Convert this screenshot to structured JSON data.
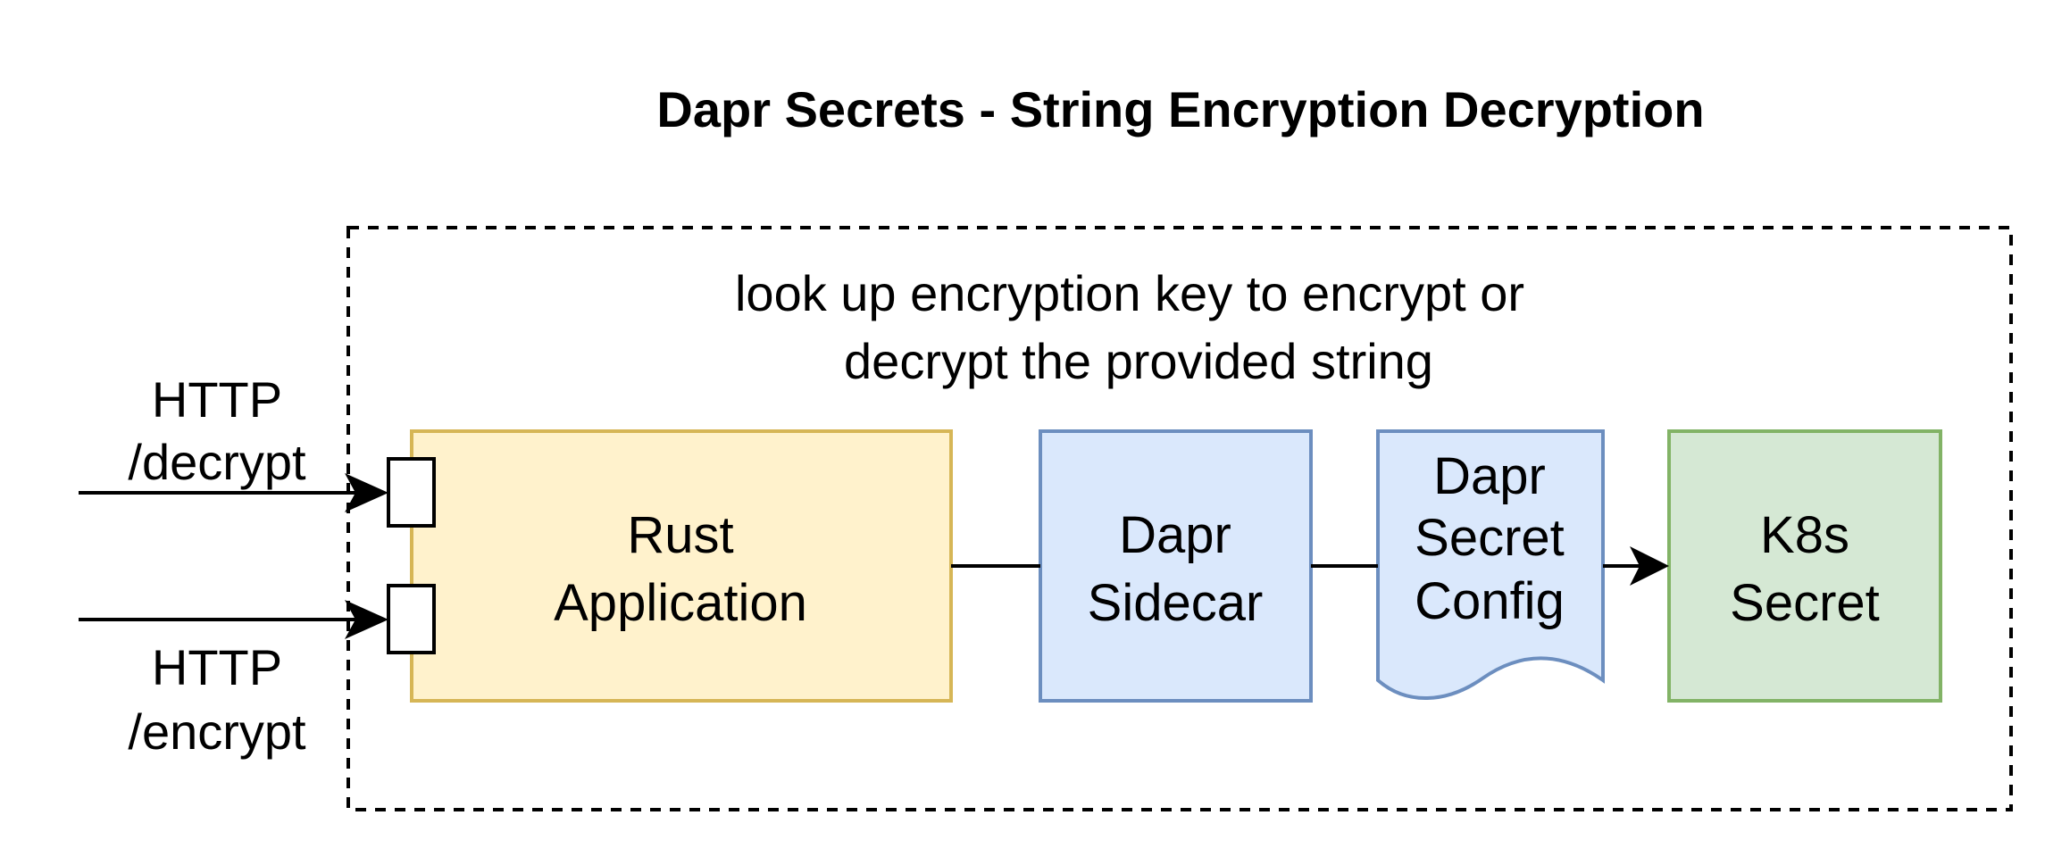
{
  "title": "Dapr Secrets - String Encryption Decryption",
  "note": {
    "line1": "look up encryption key to encrypt or",
    "line2": "decrypt the provided string"
  },
  "endpoints": {
    "decrypt": {
      "line1": "HTTP",
      "line2": "/decrypt"
    },
    "encrypt": {
      "line1": "HTTP",
      "line2": "/encrypt"
    }
  },
  "nodes": {
    "rust_app": {
      "line1": "Rust",
      "line2": "Application",
      "fill": "#fff2cc",
      "stroke": "#d6b656"
    },
    "dapr_sidecar": {
      "line1": "Dapr",
      "line2": "Sidecar",
      "fill": "#dae8fc",
      "stroke": "#6c8ebf"
    },
    "secret_config": {
      "line1": "Dapr",
      "line2": "Secret",
      "line3": "Config",
      "fill": "#dae8fc",
      "stroke": "#6c8ebf"
    },
    "k8s_secret": {
      "line1": "K8s",
      "line2": "Secret",
      "fill": "#d5e8d4",
      "stroke": "#82b366"
    }
  }
}
